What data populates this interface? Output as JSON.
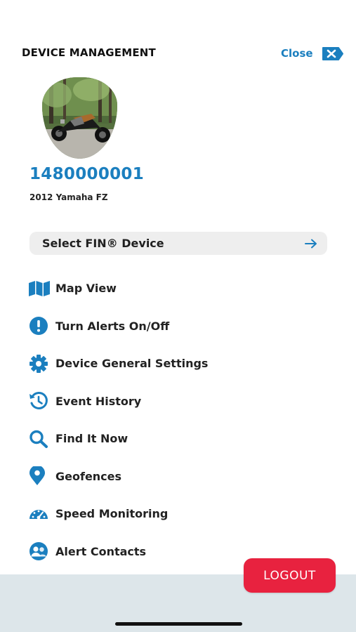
{
  "header": {
    "title": "DEVICE MANAGEMENT",
    "close_label": "Close",
    "close_icon": "close-x-icon"
  },
  "device": {
    "id": "1480000001",
    "model": "2012 Yamaha FZ",
    "photo": "motorcycle-photo"
  },
  "select_device": {
    "label": "Select FIN® Device",
    "icon": "arrow-right-icon"
  },
  "menu": {
    "items": [
      {
        "label": "Map View",
        "icon": "map-icon"
      },
      {
        "label": "Turn Alerts On/Off",
        "icon": "alert-exclamation-icon"
      },
      {
        "label": "Device General Settings",
        "icon": "gear-icon"
      },
      {
        "label": "Event History",
        "icon": "history-icon"
      },
      {
        "label": "Find It Now",
        "icon": "search-icon"
      },
      {
        "label": "Geofences",
        "icon": "map-pin-icon"
      },
      {
        "label": "Speed Monitoring",
        "icon": "speedometer-icon"
      },
      {
        "label": "Alert Contacts",
        "icon": "contacts-icon"
      }
    ]
  },
  "footer": {
    "logout_label": "LOGOUT"
  },
  "colors": {
    "accent": "#1b7fbf",
    "logout": "#e8223f",
    "footer_band": "#dde6ea",
    "select_bg": "#eeeeee"
  }
}
